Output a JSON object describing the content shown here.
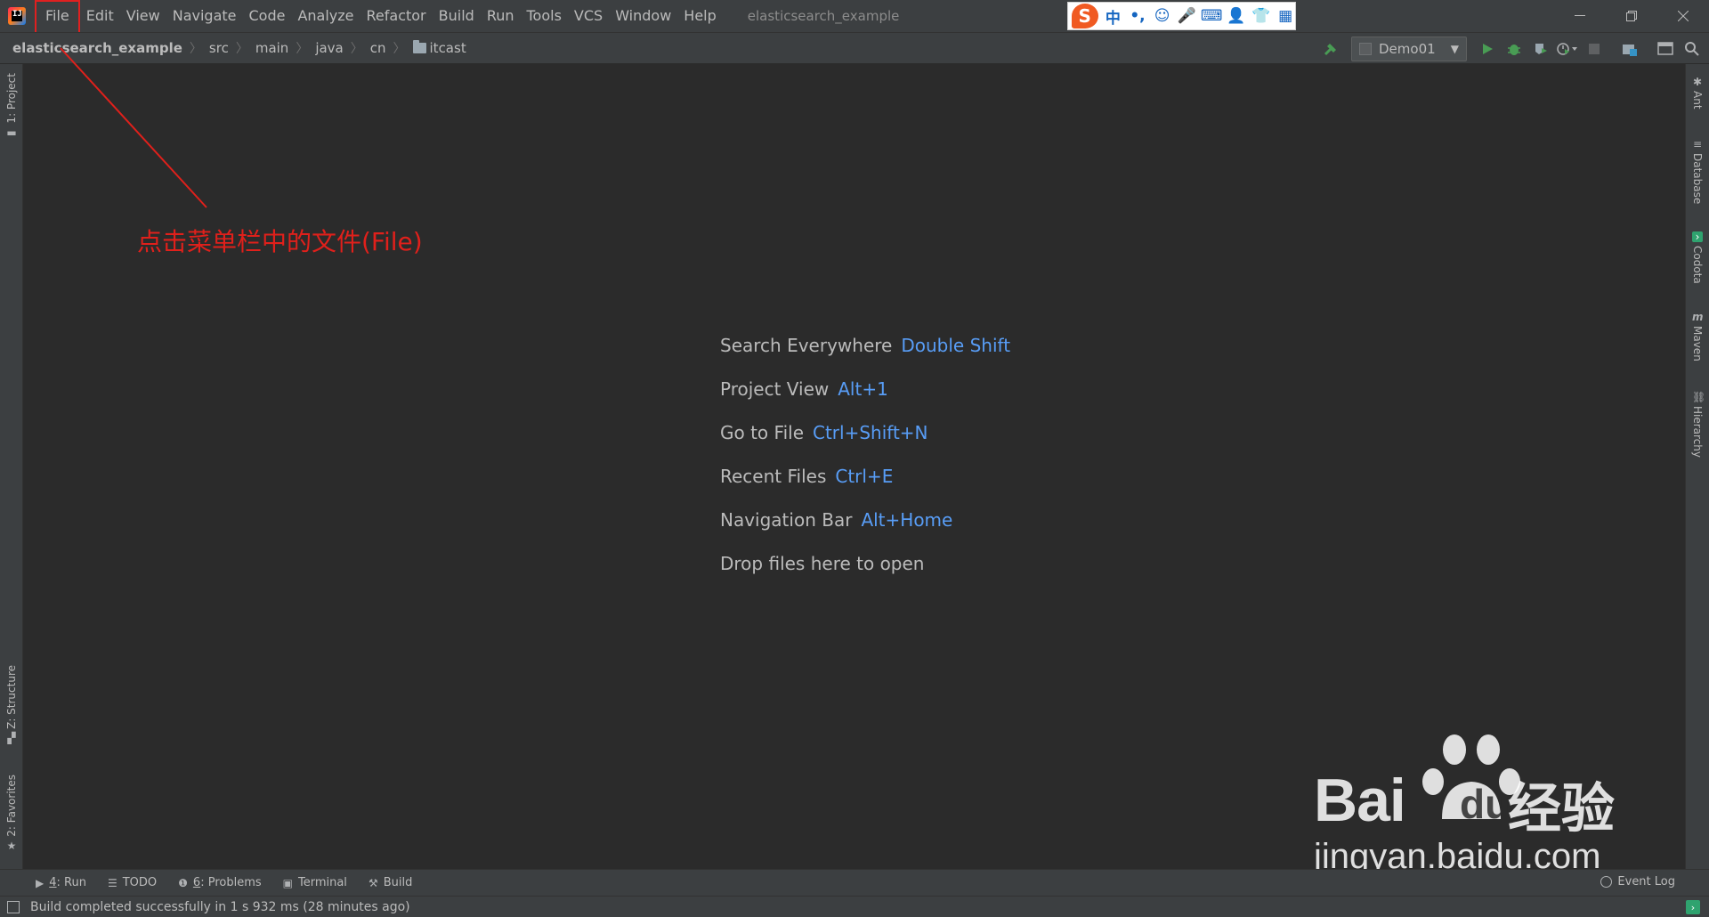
{
  "titlebar": {
    "app_logo": "intellij-idea-logo",
    "menu": [
      "File",
      "Edit",
      "View",
      "Navigate",
      "Code",
      "Analyze",
      "Refactor",
      "Build",
      "Run",
      "Tools",
      "VCS",
      "Window",
      "Help"
    ],
    "window_title": "elasticsearch_example",
    "ime_logo": "S",
    "ime_items": [
      "中",
      "•,",
      "☺",
      "🎤",
      "⌨",
      "👤",
      "👕",
      "▦"
    ]
  },
  "navbar": {
    "crumbs": [
      "elasticsearch_example",
      "src",
      "main",
      "java",
      "cn",
      "itcast"
    ],
    "run_config": "Demo01"
  },
  "left_tools": {
    "project": "1: Project",
    "structure": "Z: Structure",
    "favorites": "2: Favorites"
  },
  "right_tools": [
    "Ant",
    "Database",
    "Codota",
    "Maven",
    "Hierarchy"
  ],
  "editor_hints": [
    {
      "label": "Search Everywhere",
      "shortcut": "Double Shift"
    },
    {
      "label": "Project View",
      "shortcut": "Alt+1"
    },
    {
      "label": "Go to File",
      "shortcut": "Ctrl+Shift+N"
    },
    {
      "label": "Recent Files",
      "shortcut": "Ctrl+E"
    },
    {
      "label": "Navigation Bar",
      "shortcut": "Alt+Home"
    },
    {
      "label": "Drop files here to open",
      "shortcut": ""
    }
  ],
  "annotation": {
    "text": "点击菜单栏中的文件(File)",
    "color": "#e0201b"
  },
  "bottom_tools": {
    "run": {
      "key": "4",
      "label": ": Run"
    },
    "todo": "TODO",
    "problems": {
      "key": "6",
      "label": ": Problems"
    },
    "terminal": "Terminal",
    "build": "Build",
    "event_log": "Event Log"
  },
  "status": {
    "text": "Build completed successfully in 1 s 932 ms (28 minutes ago)"
  },
  "watermark": {
    "brand": "Bai",
    "du": "du",
    "cn": "经验",
    "url": "jingyan.baidu.com"
  },
  "colors": {
    "shortcut": "#589df6",
    "annotation": "#e0201b",
    "background": "#2b2b2b"
  }
}
